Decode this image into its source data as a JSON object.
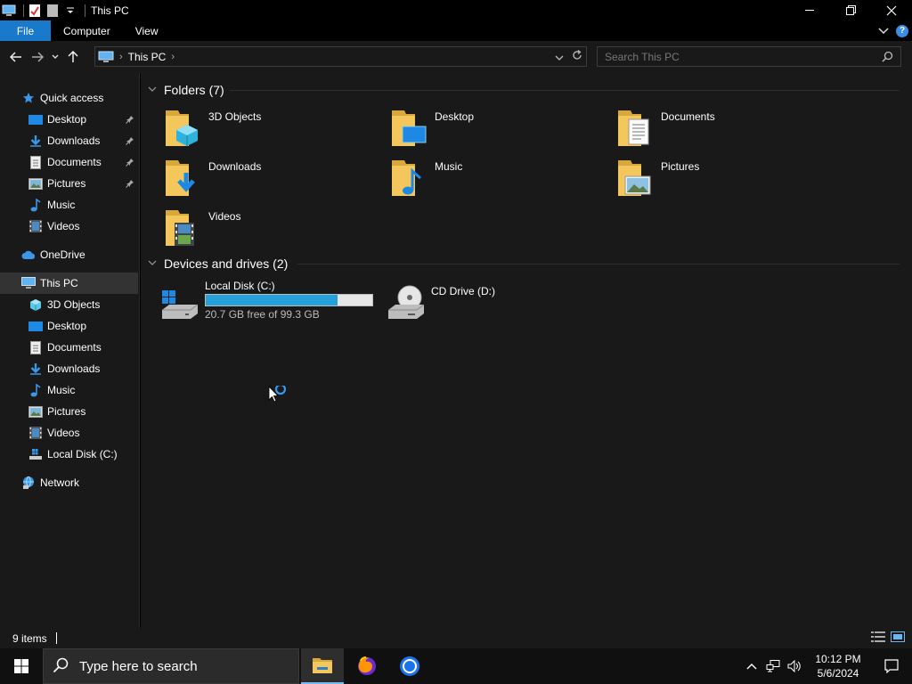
{
  "window": {
    "title": "This PC"
  },
  "ribbon": {
    "tabs": [
      "File",
      "Computer",
      "View"
    ]
  },
  "address": {
    "crumbs": [
      "This PC"
    ]
  },
  "search": {
    "placeholder": "Search This PC"
  },
  "nav": {
    "quick_access": "Quick access",
    "quick_items": [
      "Desktop",
      "Downloads",
      "Documents",
      "Pictures",
      "Music",
      "Videos"
    ],
    "onedrive": "OneDrive",
    "this_pc": "This PC",
    "pc_items": [
      "3D Objects",
      "Desktop",
      "Documents",
      "Downloads",
      "Music",
      "Pictures",
      "Videos",
      "Local Disk (C:)"
    ],
    "network": "Network"
  },
  "folders": {
    "header": "Folders (7)",
    "items": [
      "3D Objects",
      "Desktop",
      "Documents",
      "Downloads",
      "Music",
      "Pictures",
      "Videos"
    ]
  },
  "devices": {
    "header": "Devices and drives (2)",
    "local_disk": {
      "name": "Local Disk (C:)",
      "free_text": "20.7 GB free of 99.3 GB",
      "used_fraction": 0.79
    },
    "cd_drive": {
      "name": "CD Drive (D:)"
    }
  },
  "status": {
    "item_count": "9 items"
  },
  "taskbar": {
    "search_label": "Type here to search",
    "time": "10:12 PM",
    "date": "5/6/2024"
  },
  "colors": {
    "accent": "#1979ca",
    "folder": "#f4c75c",
    "drive_fill": "#26a0da"
  }
}
